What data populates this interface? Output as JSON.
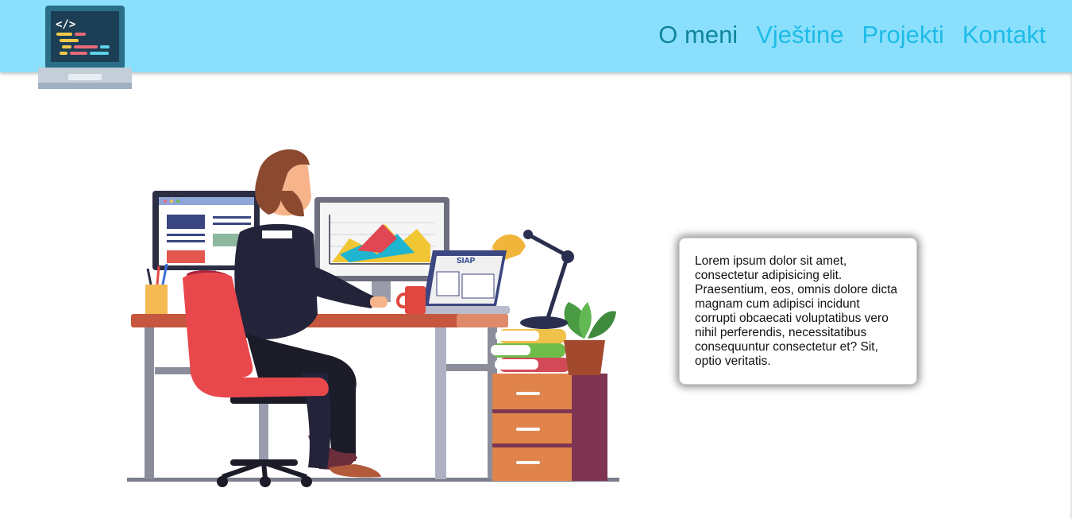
{
  "header": {
    "logo_icon": "laptop-code-icon",
    "background": "#8ae0fc",
    "nav": [
      {
        "label": "O meni",
        "active": true
      },
      {
        "label": "Vještine",
        "active": false
      },
      {
        "label": "Projekti",
        "active": false
      },
      {
        "label": "Kontakt",
        "active": false
      }
    ]
  },
  "hero": {
    "illustration": "developer-at-desk-illustration",
    "laptop_screen_text": "SIAP",
    "card_text": "Lorem ipsum dolor sit amet, consectetur adipisicing elit. Praesentium, eos, omnis dolore dicta magnam cum adipisci incidunt corrupti obcaecati voluptatibus vero nihil perferendis, necessitatibus consequuntur consectetur et? Sit, optio veritatis."
  },
  "colors": {
    "nav_link": "#1ebbe8",
    "nav_active": "#12859e"
  }
}
